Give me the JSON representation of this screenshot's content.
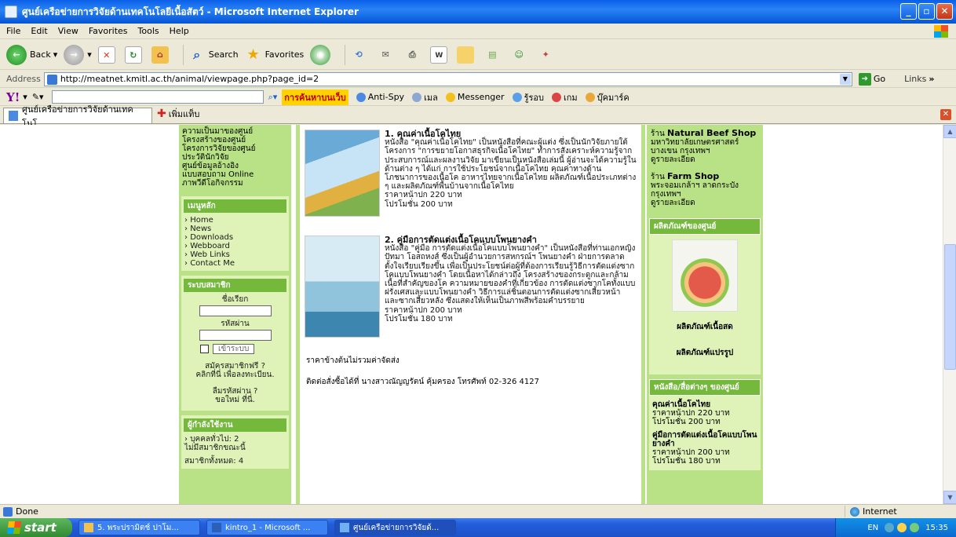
{
  "window": {
    "title": "ศูนย์เครือข่ายการวิจัยด้านเทคโนโลยีเนื้อสัตว์ - Microsoft Internet Explorer"
  },
  "menu": [
    "File",
    "Edit",
    "View",
    "Favorites",
    "Tools",
    "Help"
  ],
  "toolbar": {
    "back_label": "Back",
    "search_label": "Search",
    "favorites_label": "Favorites"
  },
  "address": {
    "label": "Address",
    "url": "http://meatnet.kmitl.ac.th/animal/viewpage.php?page_id=2",
    "go_label": "Go",
    "links_label": "Links"
  },
  "yahoo": {
    "search_button": "การค้นหาบนเว็บ",
    "items": [
      "Anti-Spy",
      "เมล",
      "Messenger",
      "รู้รอบ",
      "เกม",
      "บุ๊คมาร์ค"
    ]
  },
  "tabs": {
    "active_tab": "ศูนย์เครือข่ายการวิจัยด้านเทคโนโ...",
    "new_tab_label": "เพิ่มแท็บ"
  },
  "left": {
    "about_links": [
      "ความเป็นมาของศูนย์",
      "โครงสร้างของศูนย์",
      "โครงการวิจัยของศูนย์",
      "ประวัตินักวิจัย",
      "ศูนย์ข้อมูลอ้างอิง",
      "แบบสอบถาม Online",
      "ภาพวีดีโอกิจกรรม"
    ],
    "main_menu_title": "เมนูหลัก",
    "main_menu": [
      "Home",
      "News",
      "Downloads",
      "Webboard",
      "Web Links",
      "Contact Me"
    ],
    "member_title": "ระบบสมาชิก",
    "username_label": "ชื่อเรียก",
    "password_label": "รหัสผ่าน",
    "login_button": "เข้าระบบ",
    "register_line1": "สมัครสมาชิกฟรี ?",
    "register_line2": "คลิกที่นี่ เพื่อลงทะเบียน.",
    "forgot_line1": "ลืมรหัสผ่าน ?",
    "forgot_line2": "ขอใหม่ ที่นี่.",
    "online_title": "ผู้กำลังใช้งาน",
    "online_guests": "บุคคลทั่วไป: 2",
    "online_members": "ไม่มีสมาชิกขณะนี้",
    "online_cut": "สมาชิกทั้งหมด: 4"
  },
  "main": {
    "books": [
      {
        "title": "1. คุณค่าเนื้อโคไทย",
        "description": "หนังสือ \"คุณค่าเนื้อโคไทย\" เป็นหนังสือที่คณะผู้แต่ง ซึ่งเป็นนักวิจัยภายใต้โครงการ \"การขยายโอกาสธุรกิจเนื้อโคไทย\" ทำการสังเคราะห์ความรู้จากประสบการณ์และผลงานวิจัย มาเขียนเป็นหนังสือเล่มนี้ ผู้อ่านจะได้ความรู้ในด้านต่าง ๆ ได้แก่ การใช้ประโยชน์จากเนื้อโคไทย คุณค่าทางด้านโภชนาการของเนื้อโค อาหารไทยจากเนื้อโคไทย ผลิตภัณฑ์เนื้อประเภทต่าง ๆ และผลิตภัณฑ์พื้นบ้านจากเนื้อโคไทย",
        "price": "ราคาหน้าปก 220 บาท",
        "promo": "โปรโมชั่น 200 บาท"
      },
      {
        "title": "2. คู่มือการตัดแต่งเนื้อโคแบบโพนยางคำ",
        "description": "หนังสือ \"คู่มือ การตัดแต่งเนื้อโคแบบโพนยางคำ\" เป็นหนังสือที่ท่านเอกหญิง ปัทมา โอสถหงส์ ซึ่งเป็นผู้อำนวยการสหกรณ์ฯ โพนยางคำ ฝ่ายการตลาด ตั้งใจเรียบเรียงขึ้น เพื่อเป็นประโยชน์ต่อผู้ที่ต้องการเรียนรู้วิธีการตัดแต่งซากโคแบบโพนยางคำ โดยเนื้อหาได้กล่าวถึง โครงสร้างของกระดูกและกล้ามเนื้อที่สำคัญของโค ความหมายของคำที่เกี่ยวข้อง การตัดแต่งซากโคทั้งแบบฝรั่งเศสและแบบโพนยางคำ วิธีการแล่ชิ้นตอนการตัดแต่งซากเสี้ยวหน้า และซากเสี้ยวหลัง ซึ่งแสดงให้เห็นเป็นภาพสีพร้อมคำบรรยาย",
        "price": "ราคาหน้าปก 200 บาท",
        "promo": "โปรโมชั่น 180 บาท"
      }
    ],
    "shipping_note": "ราคาข้างต้นไม่รวมค่าจัดส่ง",
    "contact_note": "ติดต่อสั่งซื้อได้ที่  นางสาวณัญญรัตน์ คุ้มครอง   โทรศัพท์ 02-326 4127"
  },
  "right": {
    "shop1_prefix": "ร้าน",
    "shop1_name": "Natural Beef Shop",
    "shop1_addr1": "มหาวิทยาลัยเกษตรศาสตร์",
    "shop1_addr2": "บางเขน กรุงเทพฯ",
    "shop1_detail": "ดูรายละเอียด",
    "shop2_prefix": "ร้าน",
    "shop2_name": "Farm Shop",
    "shop2_addr1": "พระจอมเกล้าฯ ลาดกระบัง",
    "shop2_addr2": "กรุงเทพฯ",
    "shop2_detail": "ดูรายละเอียด",
    "products_title": "ผลิตภัณฑ์ของศูนย์",
    "product_fresh": "ผลิตภัณฑ์เนื้อสด",
    "product_processed": "ผลิตภัณฑ์แปรรูป",
    "media_title": "หนังสือ/สื่อต่างๆ ของศูนย์",
    "media_books": [
      {
        "title": "คุณค่าเนื้อโคไทย",
        "price": "ราคาหน้าปก 220 บาท",
        "promo": "โปรโมชั่น 200 บาท"
      },
      {
        "title": "คู่มือการตัดแต่งเนื้อโคแบบโพนยางคำ",
        "price": "ราคาหน้าปก 200 บาท",
        "promo": "โปรโมชั่น 180 บาท"
      }
    ]
  },
  "status": {
    "text": "Done",
    "zone": "Internet"
  },
  "taskbar": {
    "start_label": "start",
    "tasks": [
      "5. พระปรามิตช์ ปาโม...",
      "kintro_1 - Microsoft ...",
      "ศูนย์เครือข่ายการวิจัยด้..."
    ],
    "lang": "EN",
    "clock": "15:35"
  }
}
